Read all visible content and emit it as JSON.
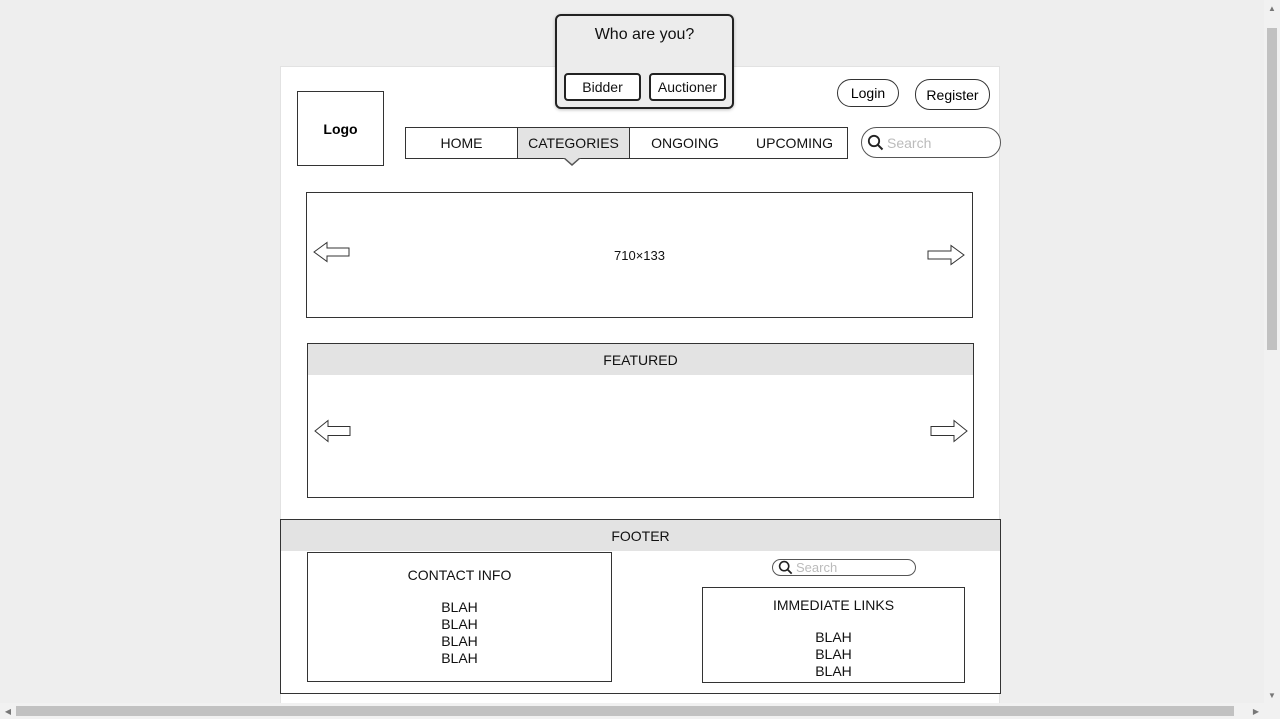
{
  "header": {
    "logo_text": "Logo",
    "login_label": "Login",
    "register_label": "Register",
    "search_placeholder": "Search"
  },
  "nav": {
    "items": [
      {
        "label": "HOME"
      },
      {
        "label": "CATEGORIES",
        "active": true
      },
      {
        "label": "ONGOING"
      },
      {
        "label": "UPCOMING"
      }
    ]
  },
  "carousel": {
    "placeholder_text": "710×133"
  },
  "featured": {
    "title": "FEATURED"
  },
  "footer": {
    "title": "FOOTER",
    "search_placeholder": "Search",
    "contact": {
      "title": "CONTACT INFO",
      "lines": [
        "BLAH",
        "BLAH",
        "BLAH",
        "BLAH"
      ]
    },
    "links": {
      "title": "IMMEDIATE LINKS",
      "lines": [
        "BLAH",
        "BLAH",
        "BLAH"
      ]
    }
  },
  "modal": {
    "title": "Who are you?",
    "bidder_label": "Bidder",
    "auctioner_label": "Auctioner"
  },
  "icons": {
    "search": "search-icon",
    "arrow_left": "arrow-left-icon",
    "arrow_right": "arrow-right-icon"
  }
}
